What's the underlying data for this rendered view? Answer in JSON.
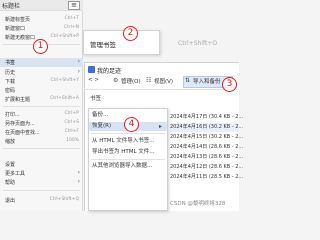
{
  "browser_menu": {
    "top_label": "标题栏",
    "button_symbol": "≡",
    "items": [
      {
        "label": "新建标签页",
        "shortcut": "Ctrl+T"
      },
      {
        "label": "新建窗口",
        "shortcut": "Ctrl+N"
      },
      {
        "label": "新建无痕窗口",
        "shortcut": "Ctrl+Shift+P"
      },
      {
        "label": "书签",
        "shortcut": ""
      },
      {
        "label": "历史",
        "shortcut": ""
      },
      {
        "label": "下载",
        "shortcut": "Ctrl+Shift+Y"
      },
      {
        "label": "密码",
        "shortcut": ""
      },
      {
        "label": "扩展和主题",
        "shortcut": "Ctrl+Shift+A"
      },
      {
        "label": "打印...",
        "shortcut": "Ctrl+P"
      },
      {
        "label": "另存页面为...",
        "shortcut": "Ctrl+S"
      },
      {
        "label": "在页面中查找...",
        "shortcut": "Ctrl+F"
      },
      {
        "label": "缩放",
        "shortcut": "100%"
      },
      {
        "label": "设置",
        "shortcut": ""
      },
      {
        "label": "更多工具",
        "shortcut": ""
      },
      {
        "label": "帮助",
        "shortcut": ""
      },
      {
        "label": "退出",
        "shortcut": "Ctrl+Shift+Q"
      }
    ]
  },
  "bookmarks_submenu": {
    "item_label": "管理书签",
    "item_shortcut": "Ctrl+Shift+O"
  },
  "library": {
    "title": "我的足迹",
    "toolbar": {
      "nav": "< >",
      "organize": "管理(O)",
      "views": "视图(V)",
      "import_backup": "导入和备份"
    },
    "dropdown": [
      {
        "label": "备份...",
        "arrow": ""
      },
      {
        "label": "恢复(R)",
        "arrow": "▸"
      },
      {
        "label": "从 HTML 文件导入书签...",
        "arrow": ""
      },
      {
        "label": "导出书签为 HTML 文件...",
        "arrow": ""
      },
      {
        "label": "从其他浏览器导入数据...",
        "arrow": ""
      }
    ],
    "tree": [
      "书签",
      "其他"
    ],
    "backups": [
      "2024年4月17日 (30.4 KB - 2...",
      "2024年4月16日 (30.2 KB - 2...",
      "2024年4月15日 (30.2 KB - 2...",
      "2024年4月14日 (28.6 KB - 2...",
      "2024年4月13日 (28.6 KB - 2...",
      "2024年4月12日 (28.6 KB - 2...",
      "2024年4月11日 (28.5 KB - 2..."
    ]
  },
  "markers": [
    "1",
    "2",
    "3",
    "4"
  ],
  "watermark": "CSDN @黎明终将328"
}
